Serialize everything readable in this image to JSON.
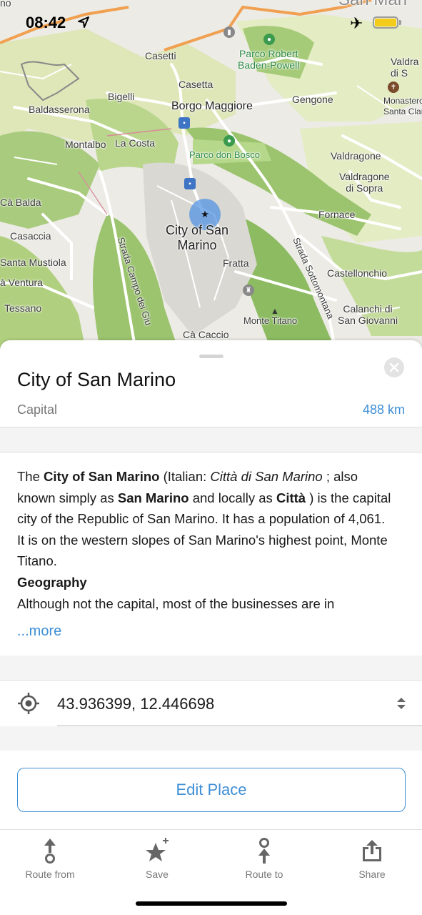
{
  "status_bar": {
    "time": "08:42"
  },
  "map": {
    "labels": {
      "casetti": "Casetti",
      "casetta": "Casetta",
      "parco_robert": "Parco Robert\nBaden-Powell",
      "valdragone_top": "Valdra\ndi S",
      "baldasserona": "Baldasserona",
      "bigelli": "Bigelli",
      "borgo_maggiore": "Borgo Maggiore",
      "gengone": "Gengone",
      "monastero": "Monastero d\nSanta Clara",
      "montalbo": "Montalbo",
      "la_costa": "La Costa",
      "parco_don_bosco": "Parco don Bosco",
      "valdragone": "Valdragone",
      "valdragone_sopra": "Valdragone\ndi Sopra",
      "ca_balda": "Cà Balda",
      "fornace": "Fornace",
      "casaccia": "Casaccia",
      "city_of_san_marino": "City of San\nMarino",
      "santa_mustiola": "Santa Mustiola",
      "fratta": "Fratta",
      "castellonchio": "Castellonchio",
      "a_ventura": "à Ventura",
      "tessano": "Tessano",
      "monte_titano": "Monte Titano",
      "calanchi": "Calanchi di\nSan Giovanni",
      "ca_caccio": "Cà Caccio",
      "strada_campo": "Strada Campo dei Giu",
      "strada_sotto": "Strada Sottomontana",
      "san_mari": "San Mari",
      "no": "no"
    }
  },
  "place": {
    "title": "City of San Marino",
    "type": "Capital",
    "distance": "488 km",
    "description": {
      "p1_a": "The ",
      "p1_b": "City of San Marino",
      "p1_c": " (Italian: ",
      "p1_d": "Città di San Marino",
      "p1_e": " ; also known simply as ",
      "p1_f": "San Marino",
      "p1_g": " and locally as ",
      "p1_h": "Città",
      "p1_i": " ) is the capital city of the Republic of San Marino. It has a population of 4,061. It is on the western slopes of San Marino's highest point, Monte Titano.",
      "heading": "Geography",
      "p2": "Although not the capital, most of the businesses are in"
    },
    "more_label": "...more",
    "coordinates": "43.936399, 12.446698",
    "edit_label": "Edit Place"
  },
  "actions": [
    {
      "label": "Route from",
      "icon": "route-from-icon"
    },
    {
      "label": "Save",
      "icon": "star-add-icon"
    },
    {
      "label": "Route to",
      "icon": "route-to-icon"
    },
    {
      "label": "Share",
      "icon": "share-icon"
    }
  ],
  "colors": {
    "accent": "#3f8fd6",
    "park": "#b8d78e",
    "forest": "#8fbf6a",
    "road_orange": "#f0a050",
    "location_dot": "#4a90e2"
  }
}
